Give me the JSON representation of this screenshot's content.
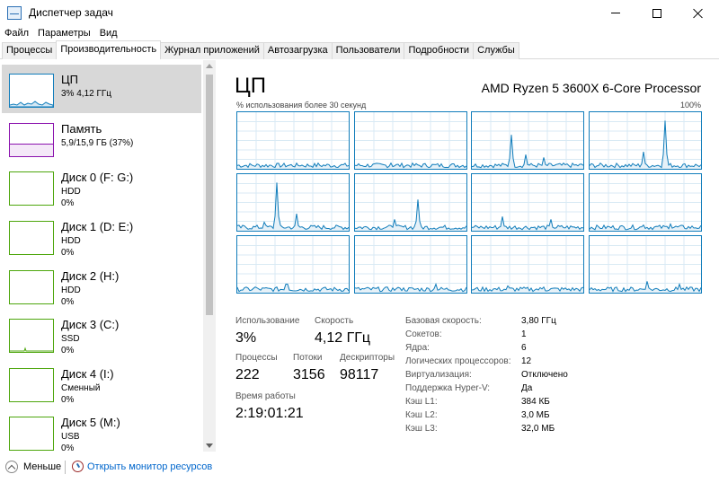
{
  "window": {
    "title": "Диспетчер задач"
  },
  "menu": [
    "Файл",
    "Параметры",
    "Вид"
  ],
  "tabs": [
    {
      "label": "Процессы",
      "active": false
    },
    {
      "label": "Производительность",
      "active": true
    },
    {
      "label": "Журнал приложений",
      "active": false
    },
    {
      "label": "Автозагрузка",
      "active": false
    },
    {
      "label": "Пользователи",
      "active": false
    },
    {
      "label": "Подробности",
      "active": false
    },
    {
      "label": "Службы",
      "active": false
    }
  ],
  "sidebar": {
    "items": [
      {
        "name": "ЦП",
        "line2": "3% 4,12 ГГц",
        "line3": "",
        "color": "#117dbb",
        "selected": true
      },
      {
        "name": "Память",
        "line2": "5,9/15,9 ГБ (37%)",
        "line3": "",
        "color": "#8b12ae",
        "selected": false
      },
      {
        "name": "Диск 0 (F: G:)",
        "line2": "HDD",
        "line3": "0%",
        "color": "#4da60c",
        "selected": false
      },
      {
        "name": "Диск 1 (D: E:)",
        "line2": "HDD",
        "line3": "0%",
        "color": "#4da60c",
        "selected": false
      },
      {
        "name": "Диск 2 (H:)",
        "line2": "HDD",
        "line3": "0%",
        "color": "#4da60c",
        "selected": false
      },
      {
        "name": "Диск 3 (C:)",
        "line2": "SSD",
        "line3": "0%",
        "color": "#4da60c",
        "selected": false
      },
      {
        "name": "Диск 4 (I:)",
        "line2": "Сменный",
        "line3": "0%",
        "color": "#4da60c",
        "selected": false
      },
      {
        "name": "Диск 5 (M:)",
        "line2": "USB",
        "line3": "0%",
        "color": "#4da60c",
        "selected": false
      }
    ]
  },
  "cpu": {
    "title": "ЦП",
    "model": "AMD Ryzen 5 3600X 6-Core Processor",
    "usage_label": "% использования более 30 секунд",
    "usage_max": "100%",
    "stats": {
      "usage_label": "Использование",
      "usage_value": "3%",
      "speed_label": "Скорость",
      "speed_value": "4,12 ГГц",
      "processes_label": "Процессы",
      "processes_value": "222",
      "threads_label": "Потоки",
      "threads_value": "3156",
      "handles_label": "Дескрипторы",
      "handles_value": "98117",
      "uptime_label": "Время работы",
      "uptime_value": "2:19:01:21"
    },
    "specs": [
      {
        "key": "Базовая скорость:",
        "value": "3,80 ГГц"
      },
      {
        "key": "Сокетов:",
        "value": "1"
      },
      {
        "key": "Ядра:",
        "value": "6"
      },
      {
        "key": "Логических процессоров:",
        "value": "12"
      },
      {
        "key": "Виртуализация:",
        "value": "Отключено"
      },
      {
        "key": "Поддержка Hyper-V:",
        "value": "Да"
      },
      {
        "key": "Кэш L1:",
        "value": "384 КБ"
      },
      {
        "key": "Кэш L2:",
        "value": "3,0 МБ"
      },
      {
        "key": "Кэш L3:",
        "value": "32,0 МБ"
      }
    ]
  },
  "footer": {
    "less_label": "Меньше",
    "monitor_link": "Открыть монитор ресурсов"
  },
  "colors": {
    "cpu_line": "#117dbb",
    "grid": "#d9eaf4",
    "link": "#0066cc"
  }
}
